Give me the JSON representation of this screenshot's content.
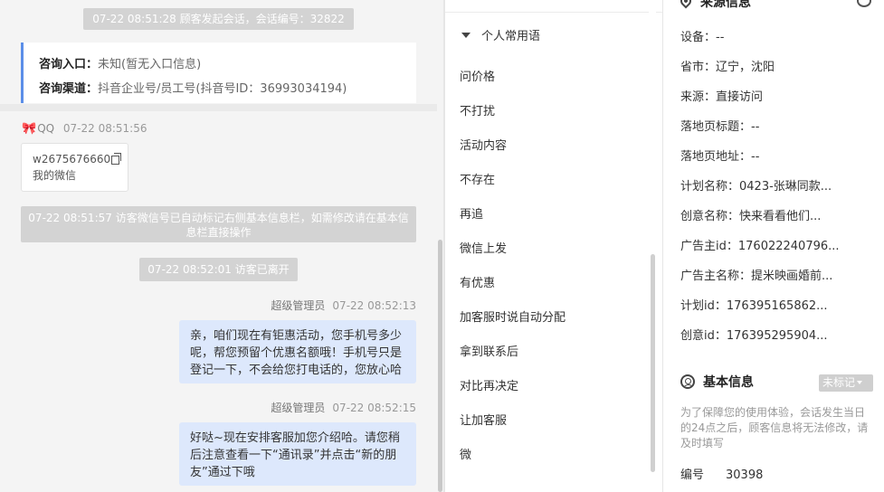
{
  "chat": {
    "session_notice": "07-22 08:51:28 顾客发起会话，会话编号：32822",
    "entry_label": "咨询入口：",
    "entry_value": "未知(暂无入口信息)",
    "channel_label": "咨询渠道：",
    "channel_value": "抖音企业号/员工号(抖音号ID：36993034194)",
    "visitor_name": "QQ",
    "visitor_time": "07-22 08:51:56",
    "visitor_msg_line1": "w2675676660",
    "visitor_msg_line2": "我的微信",
    "auto_notice": "07-22 08:51:57 访客微信号已自动标记右侧基本信息栏，如需修改请在基本信息栏直接操作",
    "left_notice": "07-22 08:52:01 访客已离开",
    "messages": [
      {
        "sender": "超级管理员",
        "time": "07-22 08:52:13",
        "text": "亲，咱们现在有钜惠活动，您手机号多少呢，帮您预留个优惠名额哦！手机号只是登记一下，不会给您打电话的，您放心哈"
      },
      {
        "sender": "超级管理员",
        "time": "07-22 08:52:15",
        "text": "好哒~现在安排客服加您介绍哈。请您稍后注意查看一下“通讯录”并点击“新的朋友”通过下哦"
      }
    ]
  },
  "phrases": {
    "group_title": "个人常用语",
    "items": [
      "问价格",
      "不打扰",
      "活动内容",
      "不存在",
      "再追",
      "微信上发",
      "有优惠",
      "加客服时说自动分配",
      "拿到联系后",
      "对比再决定",
      "让加客服",
      "微"
    ]
  },
  "info": {
    "source_title": "来源信息",
    "rows": [
      {
        "label": "设备：",
        "value": "--"
      },
      {
        "label": "省市：",
        "value": "辽宁，沈阳"
      },
      {
        "label": "来源：",
        "value": "直接访问"
      },
      {
        "label": "落地页标题：",
        "value": "--"
      },
      {
        "label": "落地页地址：",
        "value": "--"
      },
      {
        "label": "计划名称：",
        "value": "0423-张琳同款..."
      },
      {
        "label": "创意名称：",
        "value": "快来看看他们..."
      },
      {
        "label": "广告主id：",
        "value": "176022240796..."
      },
      {
        "label": "广告主名称：",
        "value": "提米映画婚前..."
      },
      {
        "label": "计划id：",
        "value": "176395165862..."
      },
      {
        "label": "创意id：",
        "value": "176395295904..."
      }
    ],
    "basic_title": "基本信息",
    "unmark_label": "未标记",
    "note": "为了保障您的使用体验，会话发生当日的24点之后，顾客信息将无法修改，请及时填写",
    "id_label": "编号",
    "id_value": "30398"
  },
  "icons": {
    "source": "location-pin-icon",
    "basic": "user-circle-icon",
    "copy": "copy-icon",
    "collapse": "caret-down-icon",
    "bow": "bow-icon"
  },
  "colors": {
    "accent_border": "#5b8ee8",
    "outgoing_bubble": "#dde8fc",
    "notice_pill": "#d3d3d3"
  }
}
